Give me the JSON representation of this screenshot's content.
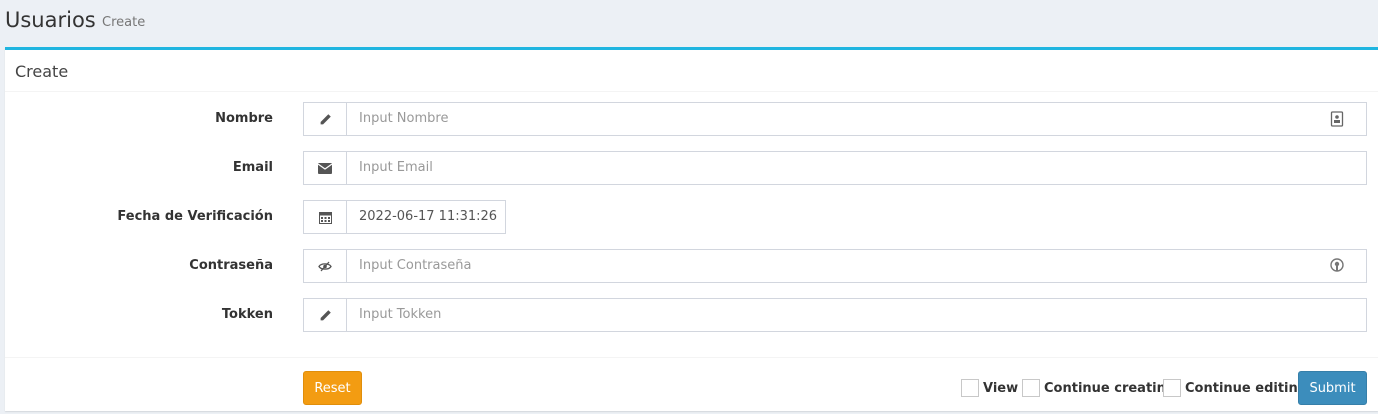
{
  "header": {
    "title": "Usuarios",
    "subtitle": "Create"
  },
  "box": {
    "title": "Create"
  },
  "fields": [
    {
      "label": "Nombre",
      "icon": "pencil-icon",
      "placeholder": "Input Nombre",
      "value": ""
    },
    {
      "label": "Email",
      "icon": "envelope-icon",
      "placeholder": "Input Email",
      "value": ""
    },
    {
      "label": "Fecha de Verificación",
      "icon": "calendar-icon",
      "placeholder": "",
      "value": "2022-06-17 11:31:26"
    },
    {
      "label": "Contraseña",
      "icon": "eye-slash-icon",
      "placeholder": "Input Contraseña",
      "value": ""
    },
    {
      "label": "Tokken",
      "icon": "pencil-icon",
      "placeholder": "Input Tokken",
      "value": ""
    }
  ],
  "footer": {
    "reset_label": "Reset",
    "submit_label": "Submit",
    "checks": [
      "View",
      "Continue creating",
      "Continue editing"
    ]
  },
  "colors": {
    "accent": "#1fb5e0",
    "reset": "#f39c12",
    "submit": "#3c8dbc"
  }
}
